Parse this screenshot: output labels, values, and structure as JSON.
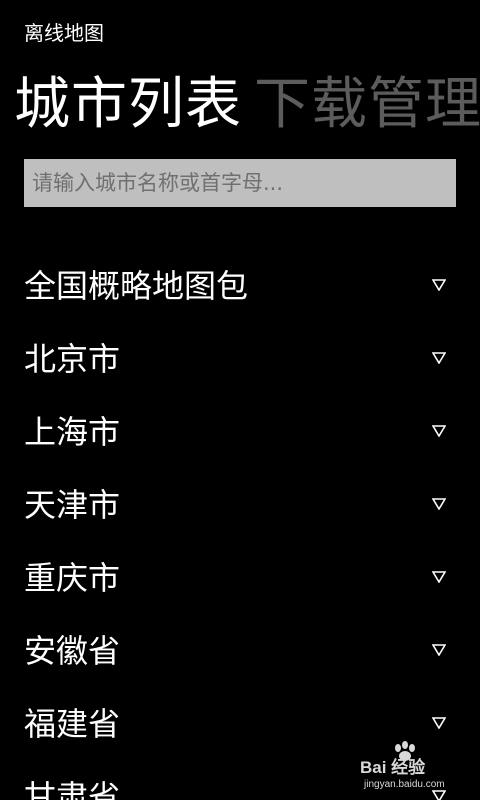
{
  "app": {
    "title": "离线地图"
  },
  "pivot": {
    "tabs": [
      {
        "label": "城市列表",
        "active": true
      },
      {
        "label": "下载管理",
        "active": false
      }
    ]
  },
  "search": {
    "placeholder": "请输入城市名称或首字母..."
  },
  "cities": [
    {
      "name": "全国概略地图包",
      "icon": "expand-triangle-icon"
    },
    {
      "name": "北京市",
      "icon": "expand-triangle-icon"
    },
    {
      "name": "上海市",
      "icon": "expand-triangle-icon"
    },
    {
      "name": "天津市",
      "icon": "expand-triangle-icon"
    },
    {
      "name": "重庆市",
      "icon": "expand-triangle-icon"
    },
    {
      "name": "安徽省",
      "icon": "expand-triangle-icon"
    },
    {
      "name": "福建省",
      "icon": "expand-triangle-icon"
    },
    {
      "name": "甘肃省",
      "icon": "expand-triangle-icon"
    }
  ],
  "watermark": {
    "brand": "Bai 经验",
    "url": "jingyan.baidu.com"
  },
  "colors": {
    "background": "#000000",
    "text": "#ffffff",
    "inactive_tab": "#5c5c5c",
    "search_bg": "#bfbfbf",
    "placeholder": "#707070"
  }
}
